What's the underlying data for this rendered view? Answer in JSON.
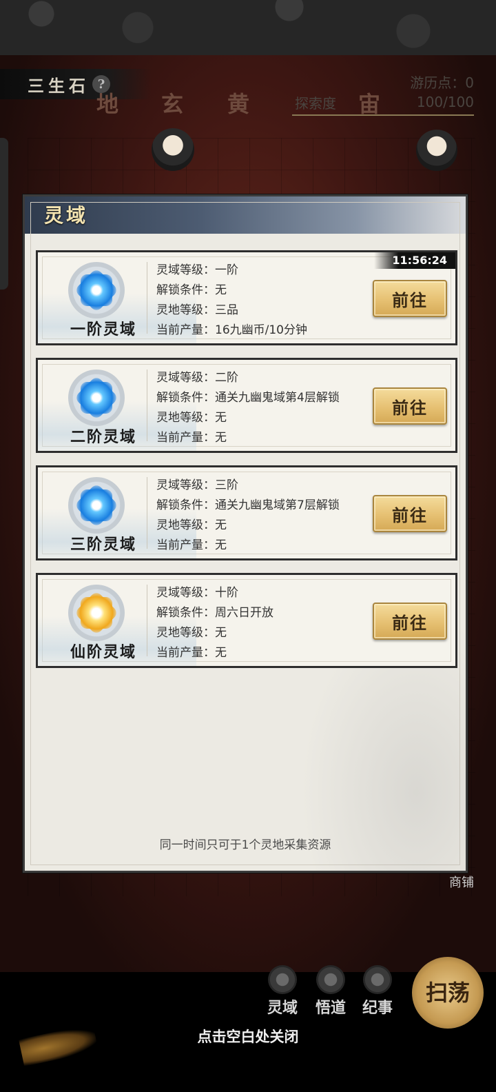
{
  "header": {
    "title": "三生石",
    "help_symbol": "?",
    "tiers": [
      "地",
      "玄",
      "黄",
      "宙"
    ],
    "travel_points_label": "游历点：",
    "travel_points_value": "0",
    "explore_label": "探索度",
    "explore_value": "100/100"
  },
  "modal": {
    "title": "灵域",
    "footer_note": "同一时间只可于1个灵地采集资源",
    "cards": [
      {
        "name": "一阶灵域",
        "orb": "blue-crystal-icon",
        "timer": "11:56:24",
        "rows": [
          {
            "k": "灵域等级：",
            "v": "一阶"
          },
          {
            "k": "解锁条件：",
            "v": "无"
          },
          {
            "k": "灵地等级：",
            "v": "三品"
          },
          {
            "k": "当前产量：",
            "v": "16九幽币/10分钟"
          }
        ],
        "button": "前往"
      },
      {
        "name": "二阶灵域",
        "orb": "blue-crystal-icon",
        "rows": [
          {
            "k": "灵域等级：",
            "v": "二阶"
          },
          {
            "k": "解锁条件：",
            "v": "通关九幽鬼域第4层解锁"
          },
          {
            "k": "灵地等级：",
            "v": "无"
          },
          {
            "k": "当前产量：",
            "v": "无"
          }
        ],
        "button": "前往"
      },
      {
        "name": "三阶灵域",
        "orb": "blue-crystal-icon",
        "rows": [
          {
            "k": "灵域等级：",
            "v": "三阶"
          },
          {
            "k": "解锁条件：",
            "v": "通关九幽鬼域第7层解锁"
          },
          {
            "k": "灵地等级：",
            "v": "无"
          },
          {
            "k": "当前产量：",
            "v": "无"
          }
        ],
        "button": "前往"
      },
      {
        "name": "仙阶灵域",
        "orb": "gold-crystal-icon",
        "rows": [
          {
            "k": "灵域等级：",
            "v": "十阶"
          },
          {
            "k": "解锁条件：",
            "v": "周六日开放"
          },
          {
            "k": "灵地等级：",
            "v": "无"
          },
          {
            "k": "当前产量：",
            "v": "无"
          }
        ],
        "button": "前往"
      }
    ]
  },
  "side": {
    "shop_label": "商铺"
  },
  "bottom_nav": {
    "items": [
      {
        "label": "灵域",
        "icon": "lotus-icon"
      },
      {
        "label": "悟道",
        "icon": "swirl-icon"
      },
      {
        "label": "纪事",
        "icon": "book-icon"
      }
    ],
    "sweep_label": "扫荡",
    "close_hint": "点击空白处关闭"
  },
  "colors": {
    "button_gold": "#e6c072",
    "panel_bg": "#eceae3",
    "header_blue": "#2f3b4d",
    "title_gold": "#f3e3b0"
  }
}
